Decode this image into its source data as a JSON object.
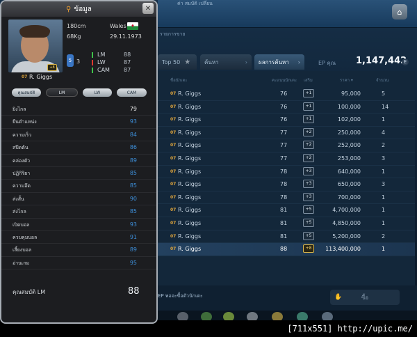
{
  "header": {
    "top_text": "ค่า สมบัติ เปลี่ยน",
    "home_icon": "home-icon"
  },
  "trade_label": "รายการขาย",
  "tabs": [
    {
      "label": "Top 50"
    },
    {
      "label": "ค้นหา"
    },
    {
      "label": "ผลการค้นหา"
    }
  ],
  "ep": {
    "label": "EP คุณ",
    "value": "1,147,442",
    "icon": "E"
  },
  "table": {
    "columns": {
      "name": "ชื่อนักเตะ",
      "ovr": "คะแนนนักเตะ",
      "boost": "เสริม",
      "price": "ราคา ▾",
      "count": "จำนวน"
    },
    "rows": [
      {
        "tag": "07",
        "name": "R. Giggs",
        "ovr": "76",
        "boost": "+1",
        "price": "95,000",
        "count": "5"
      },
      {
        "tag": "07",
        "name": "R. Giggs",
        "ovr": "76",
        "boost": "+1",
        "price": "100,000",
        "count": "14"
      },
      {
        "tag": "07",
        "name": "R. Giggs",
        "ovr": "76",
        "boost": "+1",
        "price": "102,000",
        "count": "1"
      },
      {
        "tag": "07",
        "name": "R. Giggs",
        "ovr": "77",
        "boost": "+2",
        "price": "250,000",
        "count": "4"
      },
      {
        "tag": "07",
        "name": "R. Giggs",
        "ovr": "77",
        "boost": "+2",
        "price": "252,000",
        "count": "2"
      },
      {
        "tag": "07",
        "name": "R. Giggs",
        "ovr": "77",
        "boost": "+2",
        "price": "253,000",
        "count": "3"
      },
      {
        "tag": "07",
        "name": "R. Giggs",
        "ovr": "78",
        "boost": "+3",
        "price": "640,000",
        "count": "1"
      },
      {
        "tag": "07",
        "name": "R. Giggs",
        "ovr": "78",
        "boost": "+3",
        "price": "650,000",
        "count": "3"
      },
      {
        "tag": "07",
        "name": "R. Giggs",
        "ovr": "78",
        "boost": "+3",
        "price": "700,000",
        "count": "1"
      },
      {
        "tag": "07",
        "name": "R. Giggs",
        "ovr": "81",
        "boost": "+5",
        "price": "4,700,000",
        "count": "1"
      },
      {
        "tag": "07",
        "name": "R. Giggs",
        "ovr": "81",
        "boost": "+5",
        "price": "4,850,000",
        "count": "1"
      },
      {
        "tag": "07",
        "name": "R. Giggs",
        "ovr": "81",
        "boost": "+5",
        "price": "5,200,000",
        "count": "2"
      },
      {
        "tag": "07",
        "name": "R. Giggs",
        "ovr": "88",
        "boost": "+8",
        "price": "113,400,000",
        "count": "1"
      }
    ]
  },
  "bottom": {
    "text": "EP พอจะซื้อตัวนักเตะ",
    "buy_label": "ซื้อ"
  },
  "watermark": "[711x551] http://upic.me/",
  "panel": {
    "title": "ข้อมูล",
    "close": "✕",
    "player": {
      "tag": "07",
      "name": "R. Giggs",
      "boost": "+8",
      "height": "180cm",
      "weight": "68Kg",
      "country": "Wales",
      "dob": "29.11.1973",
      "foot": "5",
      "skill": "3"
    },
    "positions": [
      {
        "name": "LM",
        "value": "88",
        "color": "#3ec24a"
      },
      {
        "name": "LW",
        "value": "87",
        "color": "#e03a2e"
      },
      {
        "name": "CAM",
        "value": "87",
        "color": "#3ec24a"
      }
    ],
    "stat_tabs": [
      "คุณสมบัติ",
      "LM",
      "LW",
      "CAM"
    ],
    "attributes": [
      {
        "name": "ยิงไกล",
        "value": "79"
      },
      {
        "name": "ยืนตำแหน่ง",
        "value": "93"
      },
      {
        "name": "ความเร็ว",
        "value": "84"
      },
      {
        "name": "สปีดต้น",
        "value": "86"
      },
      {
        "name": "คล่องตัว",
        "value": "89"
      },
      {
        "name": "ปฏิกิริยา",
        "value": "85"
      },
      {
        "name": "ความอึด",
        "value": "85"
      },
      {
        "name": "ส่งสั้น",
        "value": "90"
      },
      {
        "name": "ส่งไกล",
        "value": "85"
      },
      {
        "name": "เปิดบอล",
        "value": "93"
      },
      {
        "name": "ควบคุมบอล",
        "value": "91"
      },
      {
        "name": "เลี้ยงบอล",
        "value": "89"
      },
      {
        "name": "อ่านเกม",
        "value": "95"
      }
    ],
    "total_label": "คุณสมบัติ LM",
    "total_value": "88"
  }
}
